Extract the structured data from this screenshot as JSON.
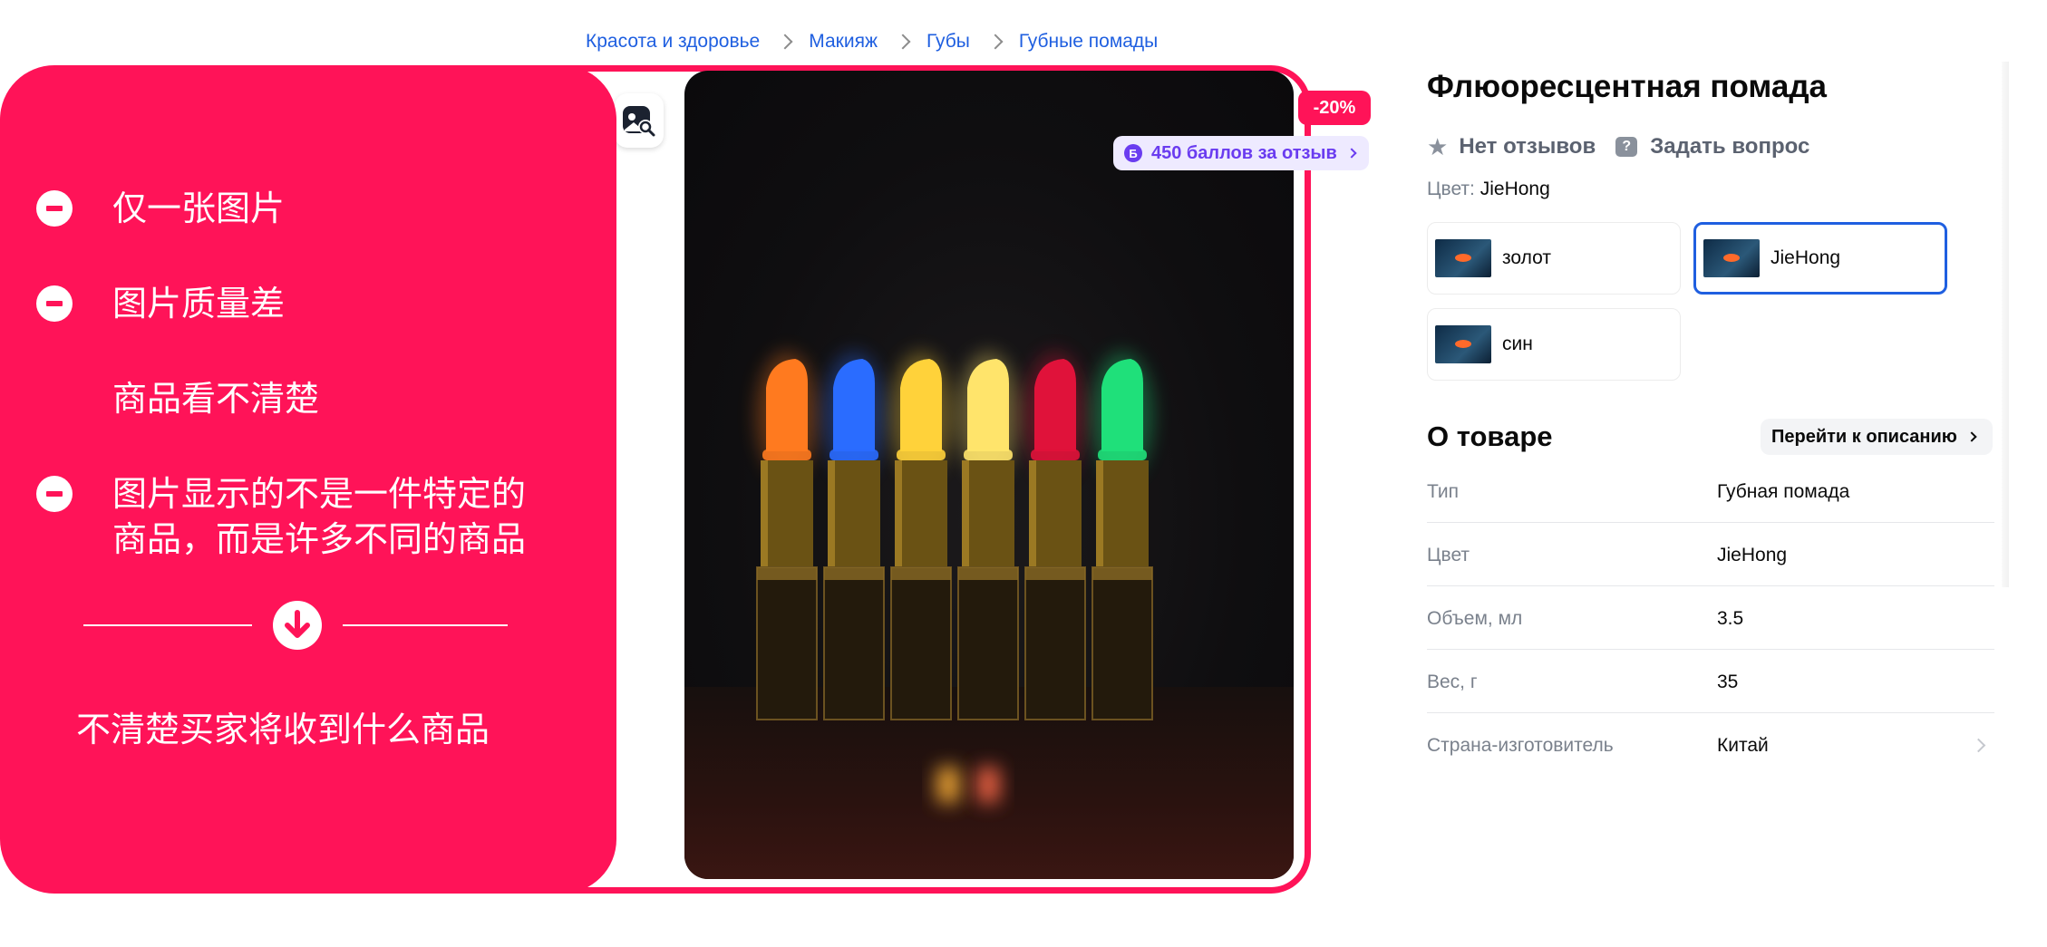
{
  "breadcrumbs": [
    "Красота и здоровье",
    "Макияж",
    "Губы",
    "Губные помады"
  ],
  "annotation": {
    "issues": [
      {
        "text": "仅一张图片",
        "marker": true
      },
      {
        "text": "图片质量差",
        "marker": true
      },
      {
        "text": "商品看不清楚",
        "marker": false
      },
      {
        "text": "图片显示的不是一件特定的",
        "text2": "商品，而是许多不同的商品",
        "marker": true
      }
    ],
    "conclusion": "不清楚买家将收到什么商品",
    "accent_color": "#ff1358"
  },
  "gallery": {
    "discount": "-20%",
    "bonus_badge": "Б",
    "bonus_text": "450 баллов за отзыв",
    "lipstick_colors": [
      "#ff7a1f",
      "#2a6cff",
      "#ffd23a",
      "#ffe46b",
      "#e0123a",
      "#1fe07a"
    ]
  },
  "product": {
    "title": "Флюоресцентная помада",
    "reviews": "Нет отзывов",
    "ask": "Задать вопрос",
    "color_label": "Цвет:",
    "color_value": "JieHong",
    "swatches": [
      {
        "label": "золот",
        "selected": false
      },
      {
        "label": "JieHong",
        "selected": true
      },
      {
        "label": "син",
        "selected": false
      }
    ]
  },
  "about": {
    "heading": "О товаре",
    "goto_label": "Перейти к описанию",
    "rows": [
      {
        "key": "Тип",
        "value": "Губная помада"
      },
      {
        "key": "Цвет",
        "value": "JieHong"
      },
      {
        "key": "Объем, мл",
        "value": "3.5"
      },
      {
        "key": "Вес, г",
        "value": "35"
      },
      {
        "key": "Страна-изготовитель",
        "value": "Китай"
      }
    ]
  }
}
